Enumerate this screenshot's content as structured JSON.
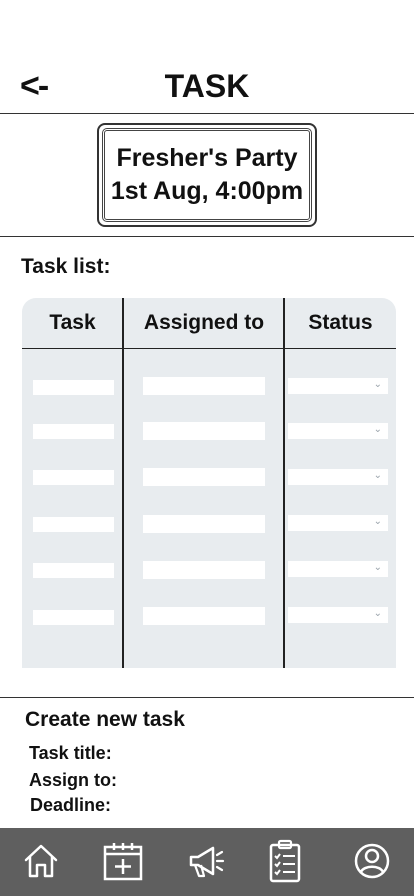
{
  "header": {
    "back_label": "<-",
    "title": "TASK"
  },
  "event": {
    "name": "Fresher's Party",
    "datetime": "1st Aug, 4:00pm"
  },
  "task_list": {
    "label": "Task list:",
    "columns": [
      "Task",
      "Assigned to",
      "Status"
    ],
    "rows": [
      {
        "task": "",
        "assigned_to": "",
        "status": ""
      },
      {
        "task": "",
        "assigned_to": "",
        "status": ""
      },
      {
        "task": "",
        "assigned_to": "",
        "status": ""
      },
      {
        "task": "",
        "assigned_to": "",
        "status": ""
      },
      {
        "task": "",
        "assigned_to": "",
        "status": ""
      },
      {
        "task": "",
        "assigned_to": "",
        "status": ""
      }
    ]
  },
  "create_task": {
    "title": "Create new task",
    "fields": [
      "Task title:",
      "Assign to:",
      "Deadline:"
    ]
  },
  "bottom_nav": {
    "items": [
      "home-icon",
      "calendar-add-icon",
      "megaphone-icon",
      "clipboard-checklist-icon",
      "profile-icon"
    ]
  },
  "colors": {
    "nav_background": "#5f5f5f",
    "table_background": "#e8ecef",
    "icon_stroke": "#ffffff"
  }
}
